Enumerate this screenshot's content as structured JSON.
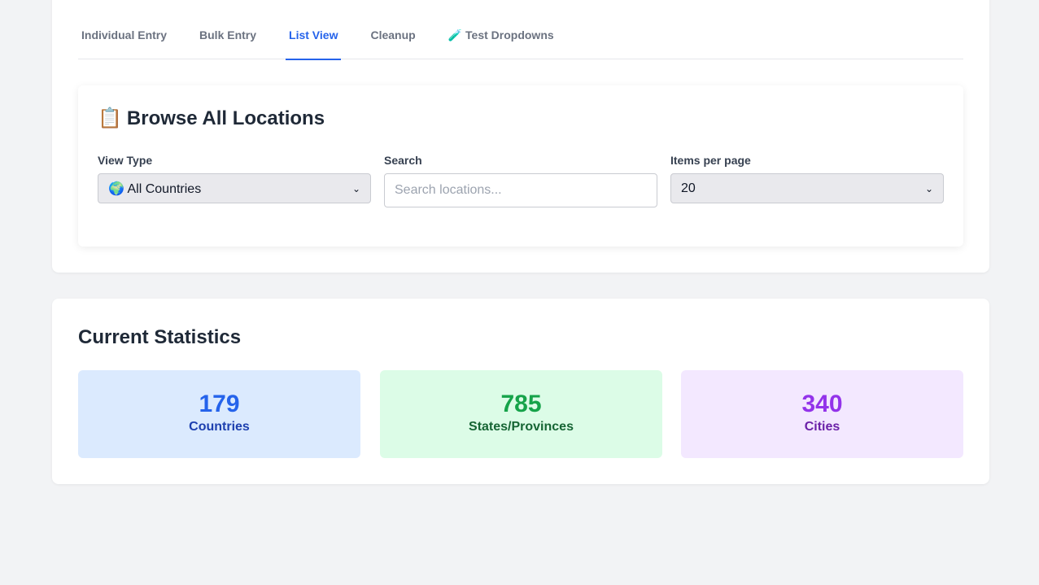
{
  "tabs": [
    "Individual Entry",
    "Bulk Entry",
    "List View",
    "Cleanup",
    "🧪 Test Dropdowns"
  ],
  "active_tab": "List View",
  "browse": {
    "title": "Browse All Locations",
    "title_icon": "📋",
    "view_type_label": "View Type",
    "view_type_value": "🌍 All Countries",
    "search_label": "Search",
    "search_placeholder": "Search locations...",
    "items_per_page_label": "Items per page",
    "items_per_page_value": "20"
  },
  "stats": {
    "title": "Current Statistics",
    "items": [
      {
        "value": "179",
        "label": "Countries",
        "bg": "#dbeafe",
        "num_color": "#2563eb",
        "lbl_color": "#1e40af"
      },
      {
        "value": "785",
        "label": "States/Provinces",
        "bg": "#dcfce7",
        "num_color": "#16a34a",
        "lbl_color": "#166534"
      },
      {
        "value": "340",
        "label": "Cities",
        "bg": "#f3e8ff",
        "num_color": "#9333ea",
        "lbl_color": "#6b21a8"
      }
    ]
  }
}
